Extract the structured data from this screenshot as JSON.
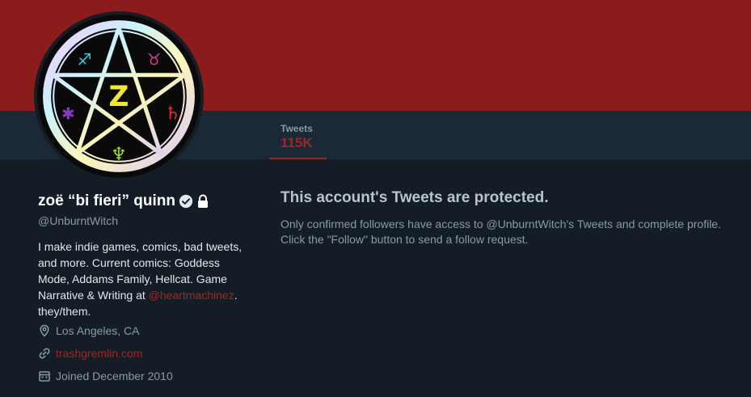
{
  "profile": {
    "display_name": "zoë “bi fieri” quinn",
    "handle": "@UnburntWitch",
    "bio_text": "I make indie games, comics, bad tweets, and more. Current comics: Goddess Mode, Addams Family, Hellcat. Game Narrative & Writing at ",
    "bio_mention": "@heartmachinez",
    "bio_tail": ". they/them.",
    "location": "Los Angeles, CA",
    "website": "trashgremlin.com",
    "joined": "Joined December 2010",
    "verified_icon": "verified-badge-icon",
    "protected_icon": "lock-icon"
  },
  "stats": {
    "tweets_label": "Tweets",
    "tweets_value": "115K"
  },
  "protected": {
    "title": "This account's Tweets are protected.",
    "body": "Only confirmed followers have access to @UnburntWitch's Tweets and complete profile. Click the \"Follow\" button to send a follow request."
  },
  "colors": {
    "banner": "#8c1c1c",
    "background": "#141d26",
    "navbar": "#1b2836",
    "accent": "#a1261f",
    "secondary_text": "#8899a6"
  }
}
